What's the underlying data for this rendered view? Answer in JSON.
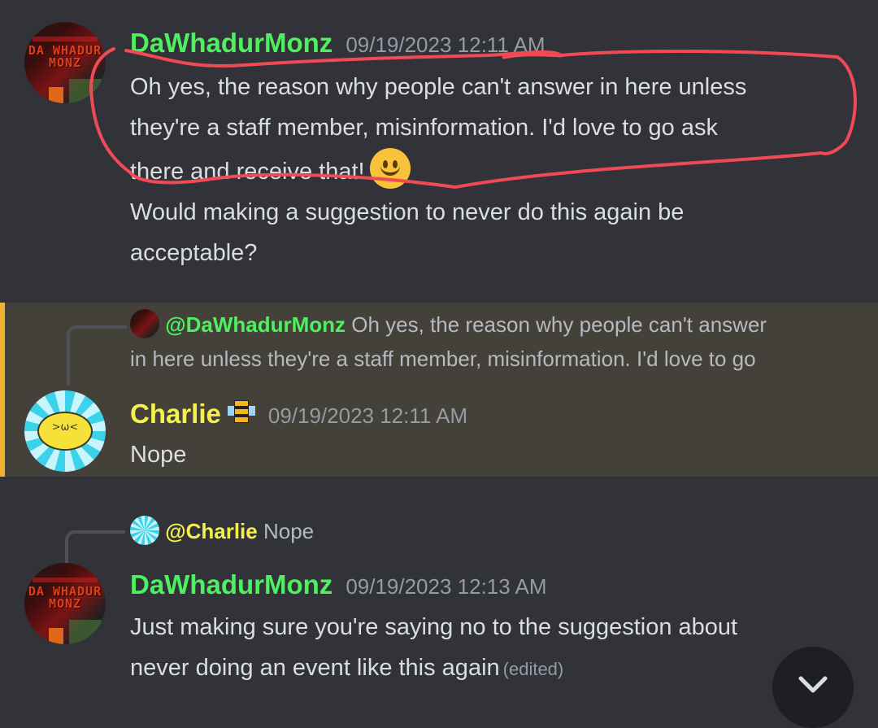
{
  "colors": {
    "background": "#313338",
    "highlight_background": "#44403a",
    "highlight_border": "#f0b232",
    "dawhadurmonz_name": "#4ff060",
    "charlie_name": "#f5f04a",
    "timestamp": "#949ba4",
    "annotation_stroke": "#f04b55"
  },
  "messages": [
    {
      "author": "DaWhadurMonz",
      "avatar_text": "DA WHADUR MONZ",
      "timestamp": "09/19/2023 12:11 AM",
      "lines": [
        "Oh yes, the reason why people can't answer in here unless",
        "they're a staff member, misinformation. I'd love to go ask",
        "there and receive that!"
      ],
      "emoji": "slightly-smiling-face",
      "followup_lines": [
        "Would making a suggestion to never do this again be",
        "acceptable?"
      ]
    },
    {
      "author": "Charlie",
      "badge": "bee-icon",
      "timestamp": "09/19/2023 12:11 AM",
      "text": "Nope",
      "avatar_face": ">ω<",
      "reply": {
        "mention": "@DaWhadurMonz",
        "line1": "Oh yes, the reason why people can't answer",
        "line2": "in here unless they're a staff member, misinformation. I'd love to go"
      }
    },
    {
      "author": "DaWhadurMonz",
      "avatar_text": "DA WHADUR MONZ",
      "timestamp": "09/19/2023 12:13 AM",
      "lines": [
        "Just making sure you're saying no to the suggestion about",
        "never doing an event like this again"
      ],
      "edited": "(edited)",
      "reply": {
        "mention": "@Charlie",
        "text": "Nope"
      }
    }
  ],
  "scroll_button": {
    "icon": "chevron-down-icon"
  }
}
